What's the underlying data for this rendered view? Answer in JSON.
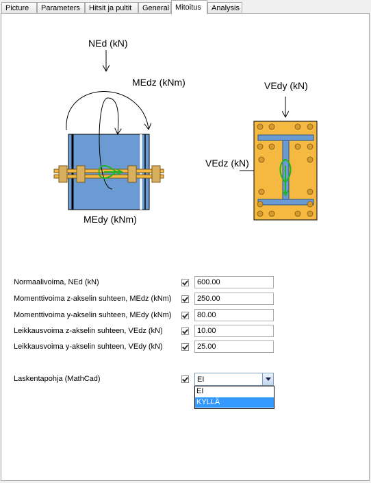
{
  "tabs": [
    {
      "label": "Picture"
    },
    {
      "label": "Parameters"
    },
    {
      "label": "Hitsit ja pultit"
    },
    {
      "label": "General"
    },
    {
      "label": "Mitoitus"
    },
    {
      "label": "Analysis"
    }
  ],
  "active_tab": "Mitoitus",
  "diagram": {
    "ned_label": "NEd (kN)",
    "medz_label": "MEdz (kNm)",
    "medy_label": "MEdy (kNm)",
    "vedy_label": "VEdy (kN)",
    "vedz_label": "VEdz (kN)"
  },
  "form": {
    "rows": [
      {
        "label": "Normaalivoima, NEd (kN)",
        "value": "600.00",
        "checked": true
      },
      {
        "label": "Momenttivoima z-akselin suhteen, MEdz (kNm)",
        "value": "250.00",
        "checked": true
      },
      {
        "label": "Momenttivoima y-akselin suhteen, MEdy (kNm)",
        "value": "80.00",
        "checked": true
      },
      {
        "label": "Leikkausvoima z-akselin suhteen, VEdz (kN)",
        "value": "10.00",
        "checked": true
      },
      {
        "label": "Leikkausvoima y-akselin suhteen, VEdy (kN)",
        "value": "25.00",
        "checked": true
      }
    ],
    "method": {
      "label": "Laskentapohja (MathCad)",
      "checked": true,
      "selected": "EI",
      "options": [
        "EI",
        "KYLLÄ"
      ],
      "highlighted": "KYLLÄ"
    }
  },
  "colors": {
    "plate_blue": "#6b9bd2",
    "plate_orange": "#f5b841",
    "highlight": "#3399ff",
    "moment_green": "#22b422"
  }
}
